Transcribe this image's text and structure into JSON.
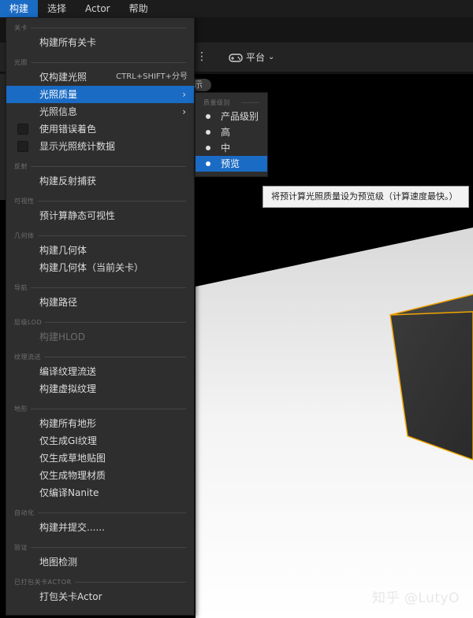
{
  "menubar": {
    "items": [
      {
        "label": "构建",
        "active": true
      },
      {
        "label": "选择",
        "active": false
      },
      {
        "label": "Actor",
        "active": false
      },
      {
        "label": "帮助",
        "active": false
      }
    ]
  },
  "toolbar": {
    "platform_label": "平台",
    "show_label": "示"
  },
  "menu": {
    "sections": [
      {
        "header": "关卡",
        "items": [
          {
            "label": "构建所有关卡"
          }
        ]
      },
      {
        "header": "光照",
        "items": [
          {
            "label": "仅构建光照",
            "shortcut": "CTRL+SHIFT+分号"
          },
          {
            "label": "光照质量",
            "submenu": true,
            "highlighted": true
          },
          {
            "label": "光照信息",
            "submenu": true
          },
          {
            "label": "使用错误着色",
            "checkbox": true
          },
          {
            "label": "显示光照统计数据",
            "checkbox": true
          }
        ]
      },
      {
        "header": "反射",
        "items": [
          {
            "label": "构建反射捕获"
          }
        ]
      },
      {
        "header": "可视性",
        "items": [
          {
            "label": "预计算静态可视性"
          }
        ]
      },
      {
        "header": "几何体",
        "items": [
          {
            "label": "构建几何体"
          },
          {
            "label": "构建几何体（当前关卡）"
          }
        ]
      },
      {
        "header": "导航",
        "items": [
          {
            "label": "构建路径"
          }
        ]
      },
      {
        "header": "层级LOD",
        "items": [
          {
            "label": "构建HLOD",
            "disabled": true
          }
        ]
      },
      {
        "header": "纹理流送",
        "items": [
          {
            "label": "编译纹理流送"
          },
          {
            "label": "构建虚拟纹理"
          }
        ]
      },
      {
        "header": "地形",
        "items": [
          {
            "label": "构建所有地形"
          },
          {
            "label": "仅生成GI纹理"
          },
          {
            "label": "仅生成草地贴图"
          },
          {
            "label": "仅生成物理材质"
          },
          {
            "label": "仅编译Nanite"
          }
        ]
      },
      {
        "header": "自动化",
        "items": [
          {
            "label": "构建并提交......"
          }
        ]
      },
      {
        "header": "验证",
        "items": [
          {
            "label": "地图检测"
          }
        ]
      },
      {
        "header": "已打包关卡ACTOR",
        "items": [
          {
            "label": "打包关卡Actor"
          }
        ]
      }
    ]
  },
  "submenu": {
    "header": "质量级别",
    "items": [
      {
        "label": "产品级别",
        "selected": false
      },
      {
        "label": "高",
        "selected": false
      },
      {
        "label": "中",
        "selected": false
      },
      {
        "label": "预览",
        "selected": true
      }
    ]
  },
  "tooltip": {
    "text": "将预计算光照质量设为预览级（计算速度最快。）"
  },
  "watermark": {
    "text": "知乎 @LutyO"
  },
  "colors": {
    "accent": "#1a6bc4",
    "menu_bg": "#2e2e2e",
    "selection_outline": "#f0a500"
  }
}
